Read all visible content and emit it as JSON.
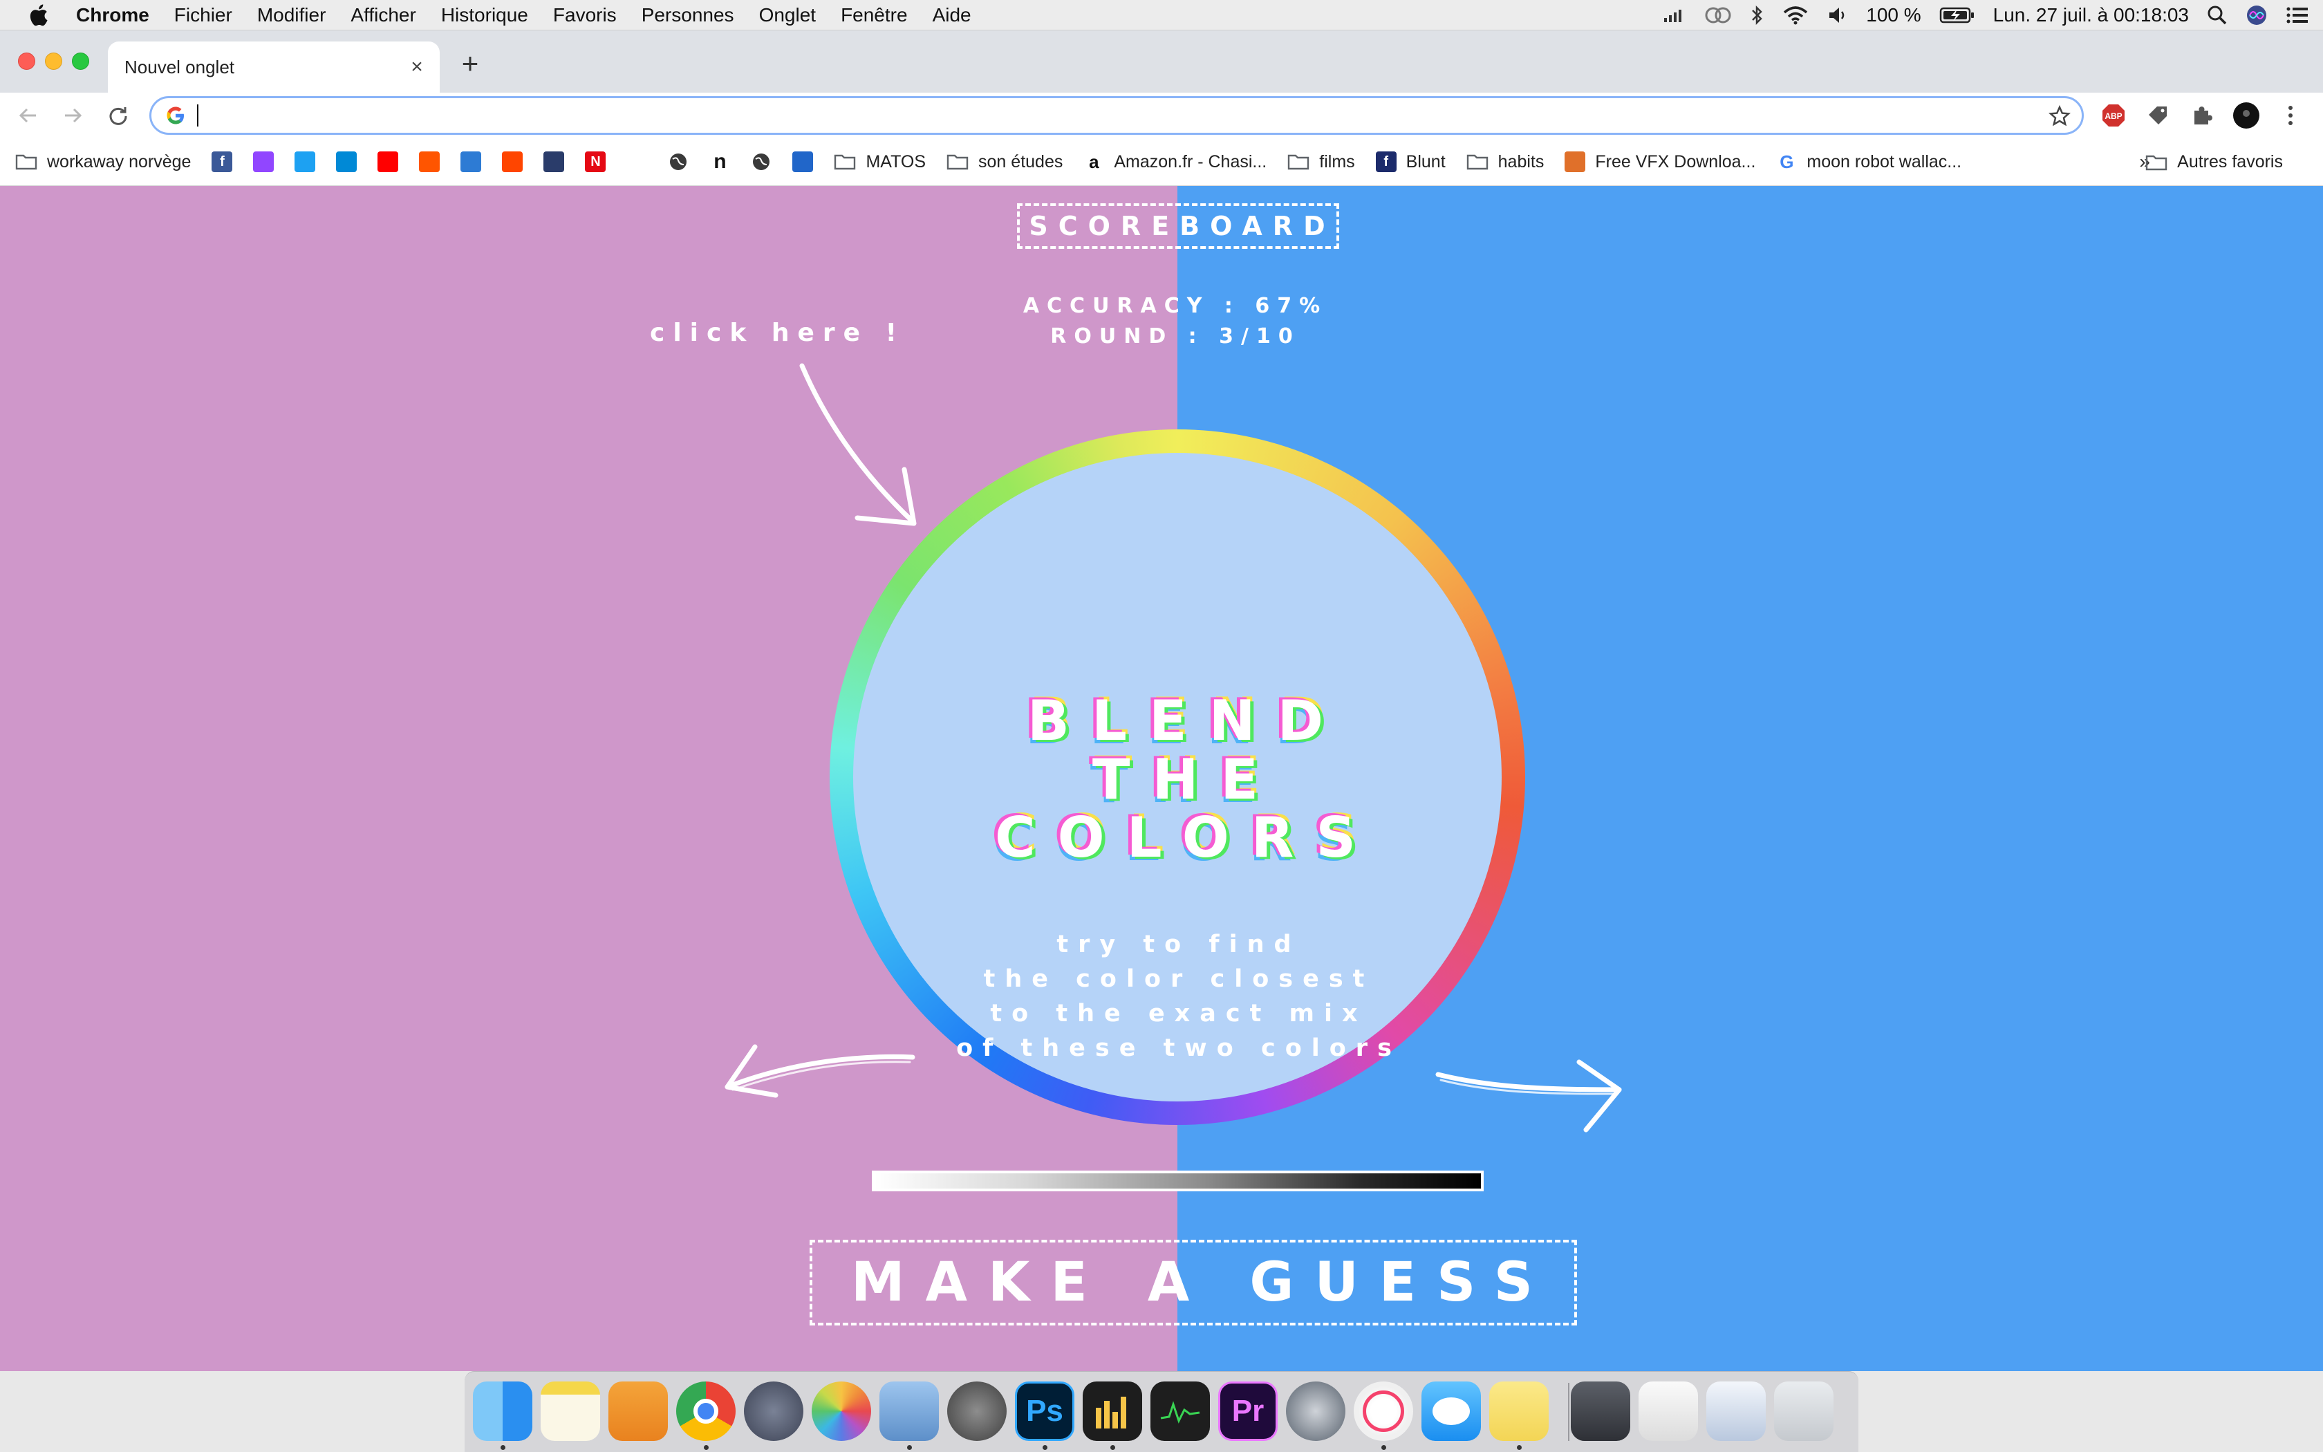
{
  "menubar": {
    "app_name": "Chrome",
    "menus": [
      "Fichier",
      "Modifier",
      "Afficher",
      "Historique",
      "Favoris",
      "Personnes",
      "Onglet",
      "Fenêtre",
      "Aide"
    ],
    "battery": "100 %",
    "datetime": "Lun. 27 juil. à  00:18:03"
  },
  "browser": {
    "tab_title": "Nouvel onglet",
    "new_tab_symbol": "+",
    "close_symbol": "×",
    "omnibox_value": "",
    "bookmarks_more": "»",
    "bookmarks": [
      {
        "label": "workaway norvège",
        "icon": "folder-icon"
      },
      {
        "label": "",
        "icon": "facebook-icon"
      },
      {
        "label": "",
        "icon": "twitch-icon"
      },
      {
        "label": "",
        "icon": "twitter-icon"
      },
      {
        "label": "",
        "icon": "azure-icon"
      },
      {
        "label": "",
        "icon": "youtube-icon"
      },
      {
        "label": "",
        "icon": "soundcloud-icon"
      },
      {
        "label": "",
        "icon": "download-icon"
      },
      {
        "label": "",
        "icon": "reddit-icon"
      },
      {
        "label": "",
        "icon": "film-icon"
      },
      {
        "label": "",
        "icon": "netflix-icon"
      },
      {
        "label": "",
        "icon": "yts-icon"
      },
      {
        "label": "",
        "icon": "globe-icon"
      },
      {
        "label": "",
        "icon": "notion-icon"
      },
      {
        "label": "",
        "icon": "globe-icon"
      },
      {
        "label": "",
        "icon": "bus-icon"
      },
      {
        "label": "MATOS",
        "icon": "folder-icon"
      },
      {
        "label": "son études",
        "icon": "folder-icon"
      },
      {
        "label": "Amazon.fr - Chasi...",
        "icon": "amazon-icon"
      },
      {
        "label": "films",
        "icon": "folder-icon"
      },
      {
        "label": "Blunt",
        "icon": "blunt-icon"
      },
      {
        "label": "habits",
        "icon": "folder-icon"
      },
      {
        "label": "Free VFX Downloa...",
        "icon": "vfx-icon"
      },
      {
        "label": "moon robot wallac...",
        "icon": "google-icon"
      }
    ],
    "other_bookmarks": "Autres favoris"
  },
  "game": {
    "scoreboard_label": "SCOREBOARD",
    "accuracy_text": "ACCURACY : 67%",
    "round_text": "ROUND : 3/10",
    "click_hint": "click here !",
    "title_lines": [
      "BLEND",
      "THE",
      "COLORS"
    ],
    "instructions": [
      "try to find",
      "the color closest",
      "to the exact mix",
      "of these two colors"
    ],
    "guess_label": "MAKE A GUESS",
    "left_color": "#cf97ca",
    "right_color": "#4ea0f3",
    "inner_color": "#b5d3f8"
  },
  "dock": {
    "apps": [
      "finder-icon",
      "notes-icon",
      "pages-icon",
      "chrome-icon",
      "launchpad-icon",
      "photos-icon",
      "preview-icon",
      "system-preferences-icon",
      "photoshop-icon",
      "audio-app-icon",
      "activity-monitor-icon",
      "premiere-icon",
      "disk-utility-icon",
      "itunes-icon",
      "messages-icon",
      "stickies-icon",
      "folder-stack-icon",
      "music-file-icon",
      "window-stack-icon",
      "trash-icon"
    ],
    "photoshop_label": "Ps",
    "premiere_label": "Pr"
  }
}
